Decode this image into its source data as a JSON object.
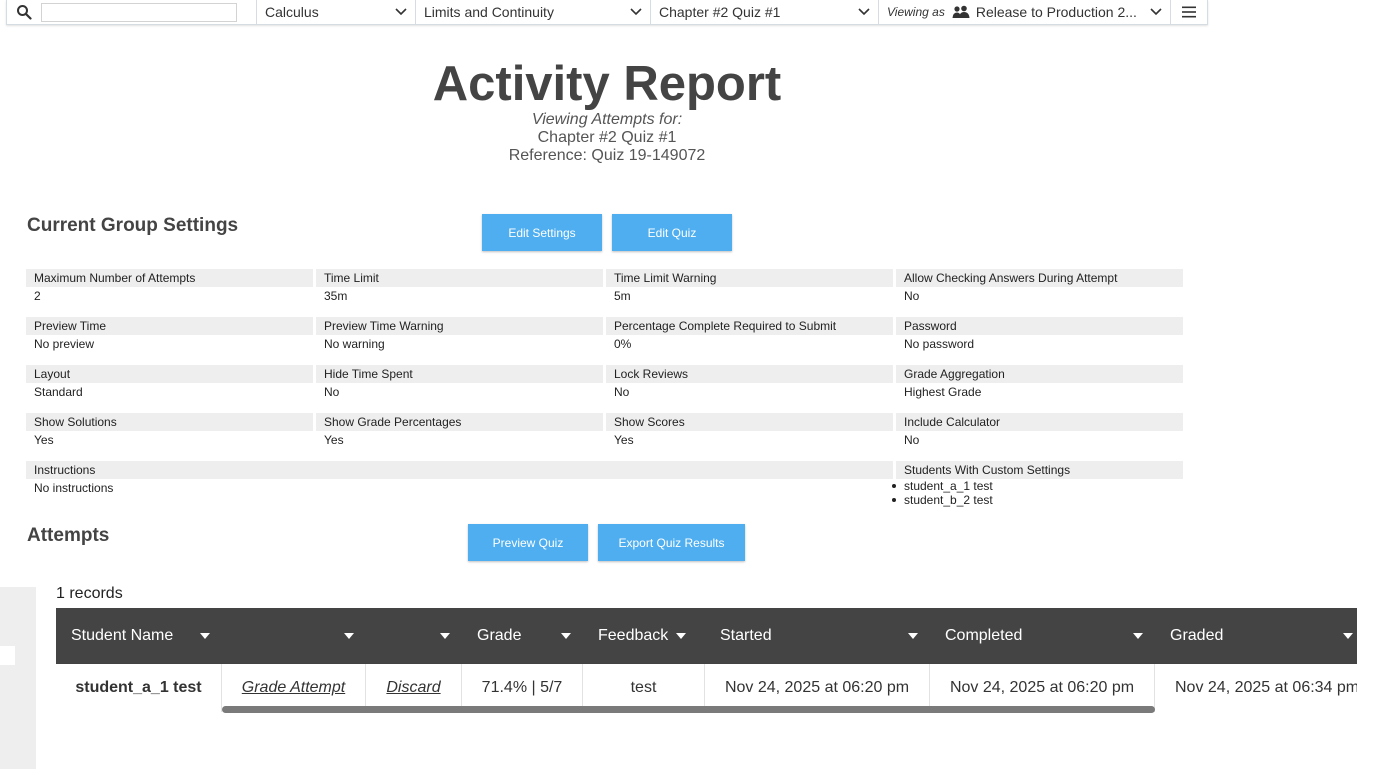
{
  "topbar": {
    "search_placeholder": "",
    "course": "Calculus",
    "unit": "Limits and Continuity",
    "quiz": "Chapter #2 Quiz #1",
    "viewing_as_label": "Viewing as",
    "viewing_as_value": "Release to Production 2..."
  },
  "header": {
    "title": "Activity Report",
    "viewing_attempts": "Viewing Attempts for:",
    "quiz_name": "Chapter #2 Quiz #1",
    "reference": "Reference: Quiz 19-149072"
  },
  "settings_section": {
    "title": "Current Group Settings",
    "edit_settings": "Edit Settings",
    "edit_quiz": "Edit Quiz",
    "rows": [
      [
        {
          "label": "Maximum Number of Attempts",
          "value": "2"
        },
        {
          "label": "Time Limit",
          "value": "35m"
        },
        {
          "label": "Time Limit Warning",
          "value": "5m"
        },
        {
          "label": "Allow Checking Answers During Attempt",
          "value": "No"
        }
      ],
      [
        {
          "label": "Preview Time",
          "value": "No preview"
        },
        {
          "label": "Preview Time Warning",
          "value": "No warning"
        },
        {
          "label": "Percentage Complete Required to Submit",
          "value": "0%"
        },
        {
          "label": "Password",
          "value": "No password"
        }
      ],
      [
        {
          "label": "Layout",
          "value": "Standard"
        },
        {
          "label": "Hide Time Spent",
          "value": "No"
        },
        {
          "label": "Lock Reviews",
          "value": "No"
        },
        {
          "label": "Grade Aggregation",
          "value": "Highest Grade"
        }
      ],
      [
        {
          "label": "Show Solutions",
          "value": "Yes"
        },
        {
          "label": "Show Grade Percentages",
          "value": "Yes"
        },
        {
          "label": "Show Scores",
          "value": "Yes"
        },
        {
          "label": "Include Calculator",
          "value": "No"
        }
      ]
    ],
    "instructions": {
      "label": "Instructions",
      "value": "No instructions"
    },
    "custom_settings": {
      "label": "Students With Custom Settings",
      "students": [
        "student_a_1 test",
        "student_b_2 test"
      ]
    }
  },
  "attempts_section": {
    "title": "Attempts",
    "preview_quiz": "Preview Quiz",
    "export_results": "Export Quiz Results",
    "records": "1 records",
    "columns": [
      "Student Name",
      "",
      "",
      "Grade",
      "Feedback",
      "Started",
      "Completed",
      "Graded"
    ],
    "rows": [
      {
        "student": "student_a_1 test",
        "grade_attempt": "Grade Attempt",
        "discard": "Discard",
        "grade": "71.4% | 5/7",
        "feedback": "test",
        "started": "Nov 24, 2025 at 06:20 pm",
        "completed": "Nov 24, 2025 at 06:20 pm",
        "graded": "Nov 24, 2025 at 06:34 pm"
      }
    ]
  },
  "colors": {
    "accent": "#4eaef0",
    "table_header": "#444444",
    "label_bg": "#eeeeee"
  }
}
